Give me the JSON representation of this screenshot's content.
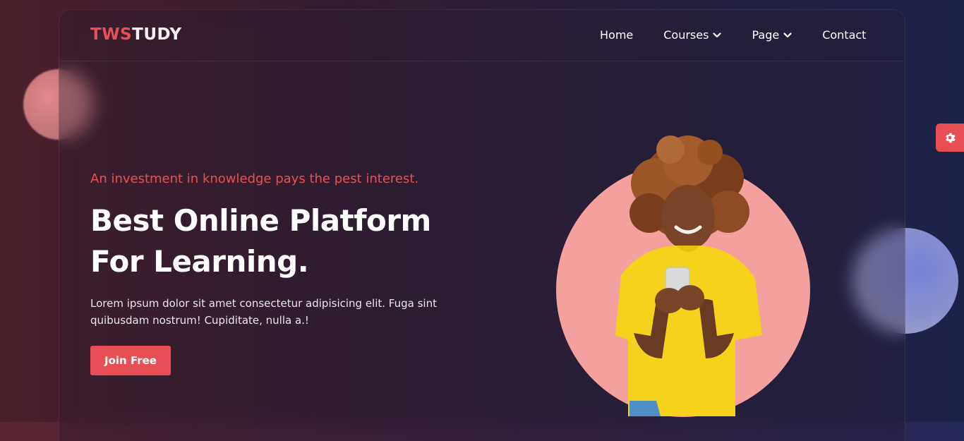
{
  "logo": {
    "part1": "TWS",
    "part2": "TUDY"
  },
  "nav": {
    "items": [
      {
        "label": "Home",
        "has_dropdown": false
      },
      {
        "label": "Courses",
        "has_dropdown": true
      },
      {
        "label": "Page",
        "has_dropdown": true
      },
      {
        "label": "Contact",
        "has_dropdown": false
      }
    ]
  },
  "hero": {
    "tagline": "An investment in knowledge pays the pest interest.",
    "headline_line1": "Best Online Platform",
    "headline_line2": "For Learning.",
    "description": "Lorem ipsum dolor sit amet consectetur adipisicing elit. Fuga sint quibusdam nostrum! Cupiditate, nulla a.!",
    "cta_label": "Join Free"
  },
  "icons": {
    "settings": "gear-icon",
    "dropdown": "chevron-down-icon"
  },
  "colors": {
    "accent": "#e84f55",
    "circle": "#f4a09e",
    "shirt": "#f7d21c"
  }
}
